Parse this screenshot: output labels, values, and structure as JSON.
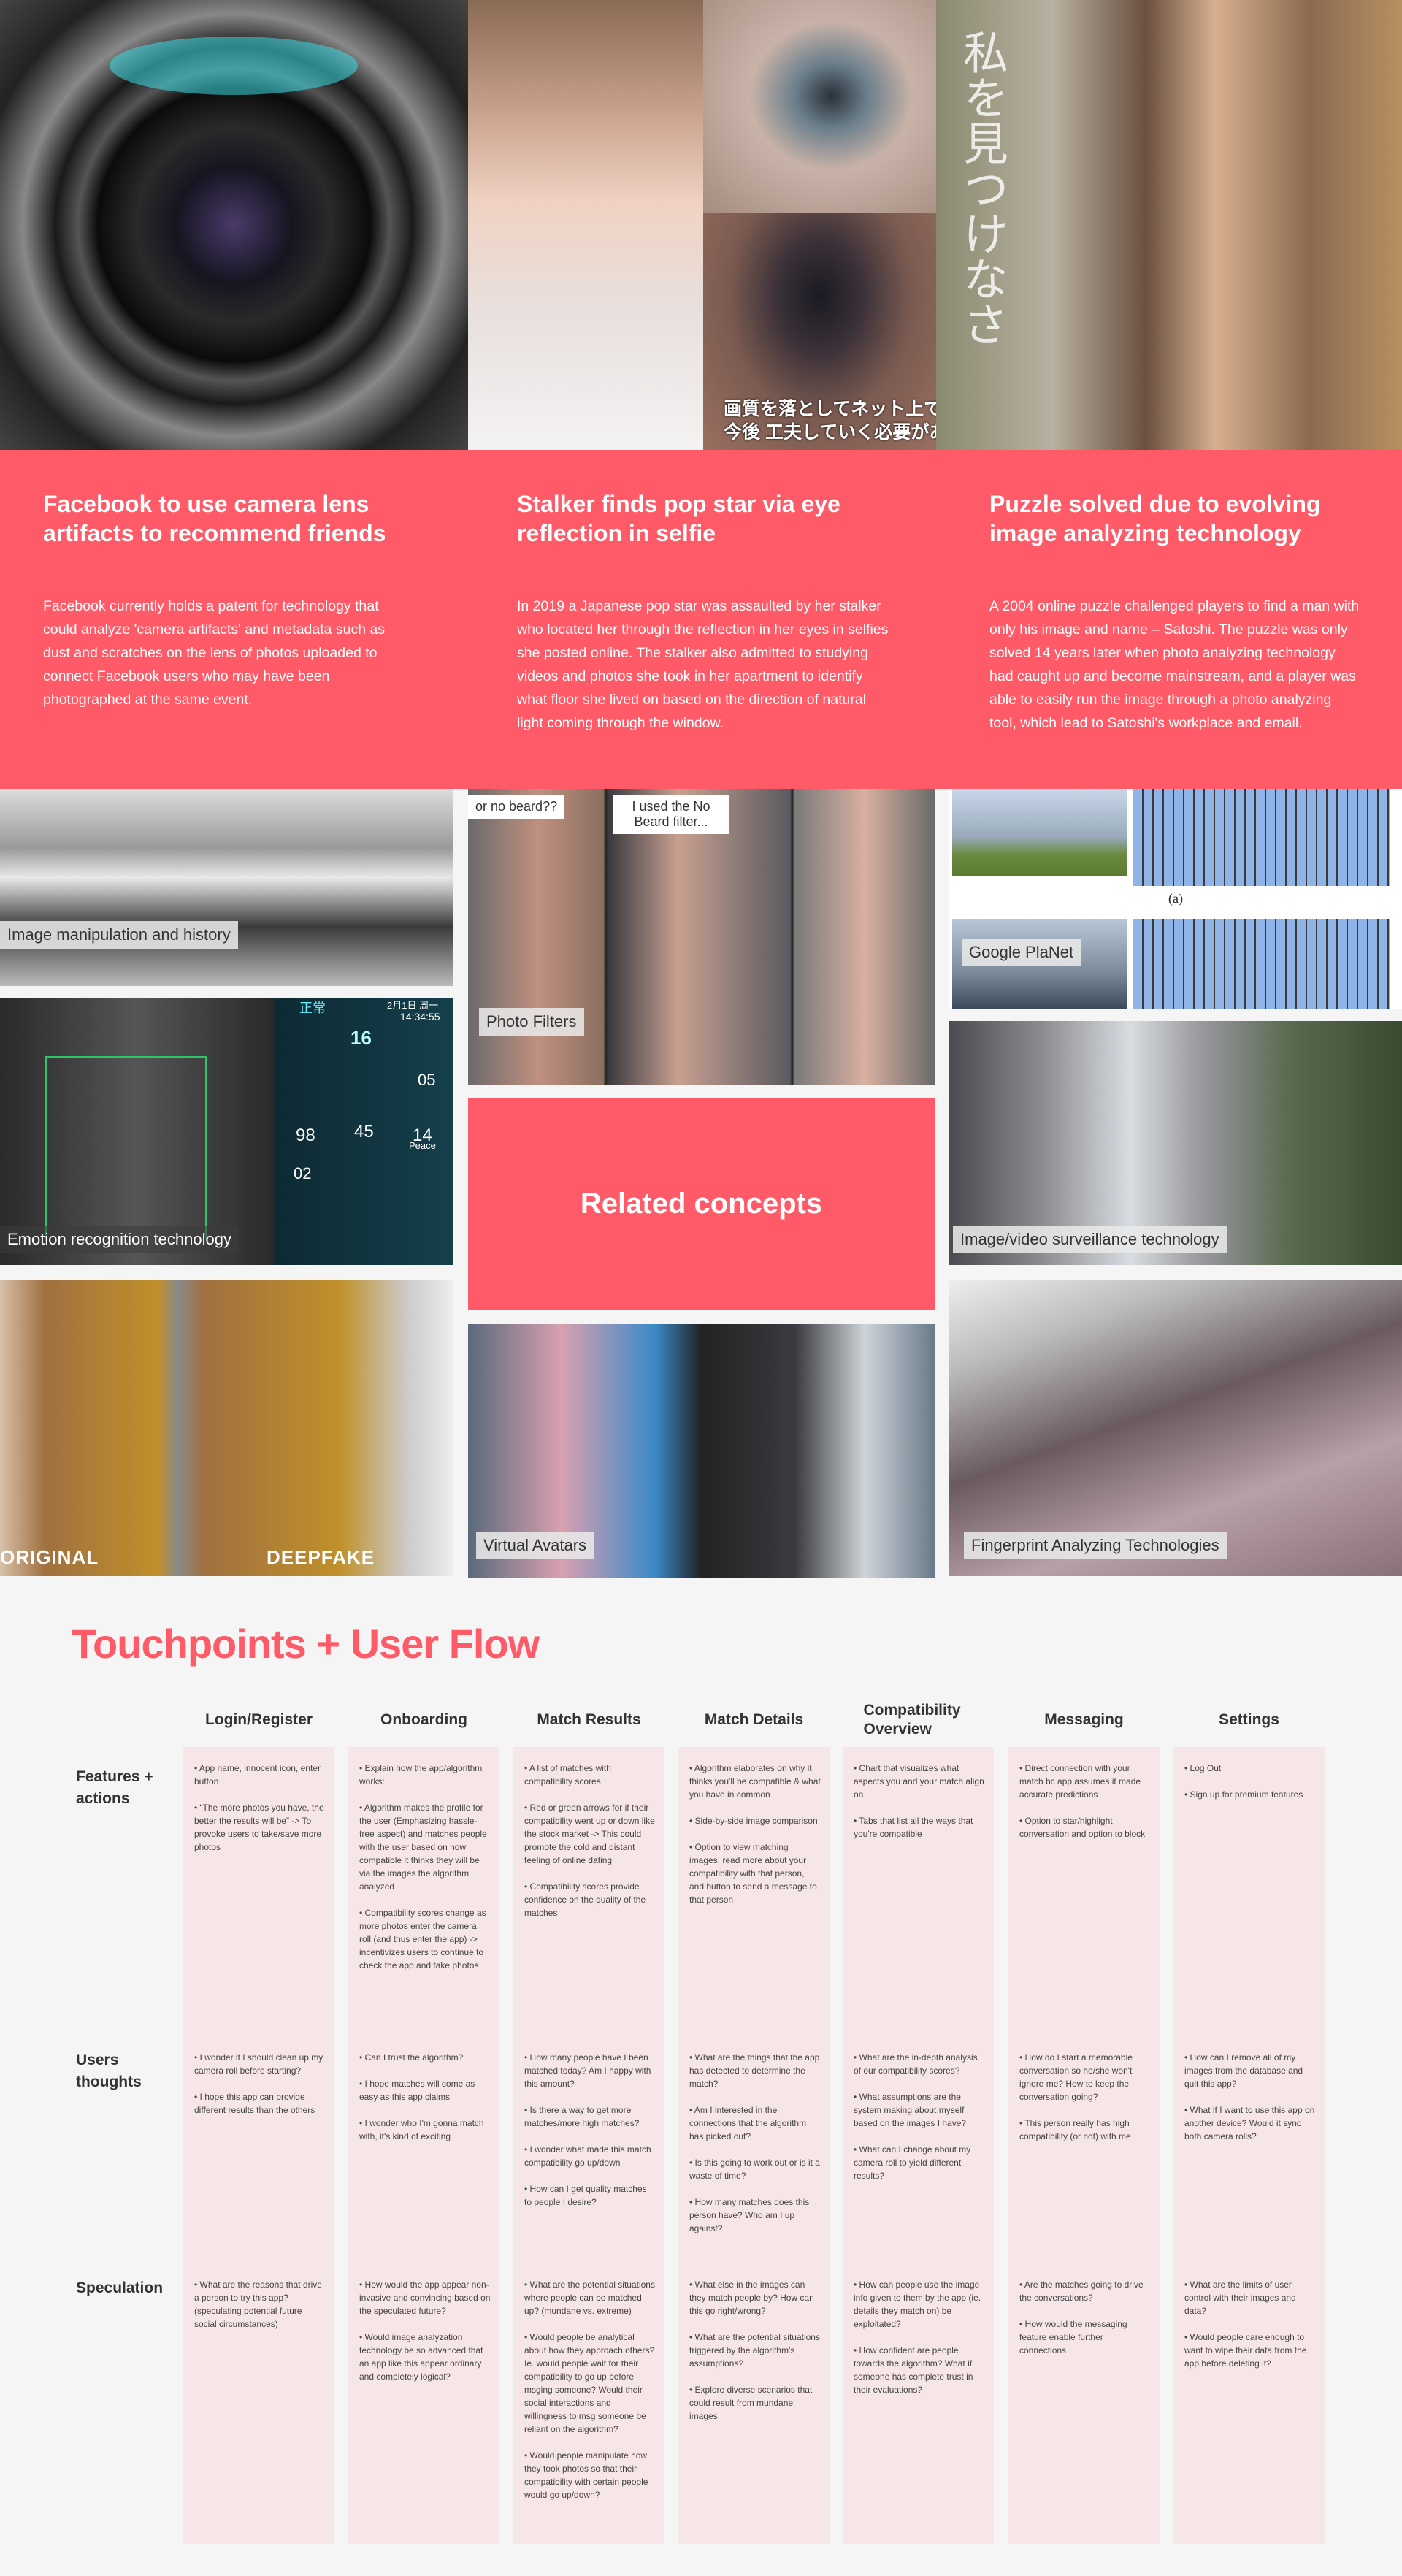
{
  "colors": {
    "accent": "#ff5a67",
    "cell_bg": "#f7e6e8",
    "page_bg": "#f5f5f5"
  },
  "hero_images": {
    "camera_lens": "camera-lens-photo",
    "pop_star": "pop-star-selfie-photo",
    "eye_reflection": "eye-reflection-photo",
    "news_caption": [
      "画質を落としてネット上で見られ",
      "今後 工夫していく必要があるのか"
    ],
    "puzzle_man": "satoshi-photo",
    "puzzle_text": "私を見つけなさ"
  },
  "stories": [
    {
      "title": "Facebook to use camera lens artifacts to recommend friends",
      "body": "Facebook currently holds a patent for technology that could analyze 'camera artifacts' and metadata such as dust and scratches on the lens of photos uploaded to connect Facebook users who may have been photographed at the same event."
    },
    {
      "title": "Stalker finds pop star via eye reflection in selfie",
      "body": "In 2019 a Japanese pop star was assaulted by her stalker who located her through the reflection in her eyes in selfies she posted online. The stalker also admitted to studying videos and photos she took in her apartment to identify what floor she lived on based on the direction of natural light coming through the window."
    },
    {
      "title": "Puzzle solved due to evolving image analyzing technology",
      "body": "A 2004 online puzzle challenged players to find a man with only his image and name – Satoshi. The puzzle was only solved 14 years later when photo analyzing technology had caught up and become mainstream, and a player was able to easily run the image through a photo analyzing tool, which lead to Satoshi's workplace and email."
    }
  ],
  "concepts": {
    "related_label": "Related concepts",
    "image_manipulation": "Image manipulation and history",
    "photo_filters": "Photo Filters",
    "photo_filters_overlays": [
      "or no beard??",
      "I used the No Beard filter..."
    ],
    "google_planet": "Google PlaNet",
    "google_planet_fig": "(a)",
    "emotion": "Emotion recognition technology",
    "emotion_hud": {
      "status": "正常",
      "date": "2月1日 周一",
      "time": "14:34:55",
      "speed": "16",
      "v1": "05",
      "v2": "98",
      "v3": "45",
      "v4": "14",
      "v5": "02",
      "mood": "Peace"
    },
    "surveillance": "Image/video surveillance technology",
    "deepfake_labels": [
      "ORIGINAL",
      "DEEPFAKE"
    ],
    "virtual_avatars": "Virtual Avatars",
    "fingerprint": "Fingerprint Analyzing Technologies"
  },
  "flow": {
    "title": "Touchpoints + User Flow",
    "columns": [
      "Login/Register",
      "Onboarding",
      "Match Results",
      "Match Details",
      "Compatibility Overview",
      "Messaging",
      "Settings"
    ],
    "rows": [
      "Features + actions",
      "Users thoughts",
      "Speculation"
    ],
    "cells": [
      [
        [
          "• App name, innocent icon, enter button",
          "• “The more photos you have, the better the results will be” -> To provoke users to take/save more photos"
        ],
        [
          "• I wonder if I should clean up my camera roll before starting?",
          "• I hope this app can provide different results than the others"
        ],
        [
          "• What are the reasons that drive a person to try this app? (speculating potential future social circumstances)"
        ]
      ],
      [
        [
          "• Explain how the app/algorithm works:",
          "• Algorithm makes the profile for the user (Emphasizing hassle-free aspect) and matches people with the user based on how compatible it thinks they will be via the images the algorithm analyzed",
          "• Compatibility scores change as more photos enter the camera roll (and thus enter the app) -> incentivizes users to continue to check the app and take photos"
        ],
        [
          "• Can I trust the algorithm?",
          "• I hope matches will come as easy as this app claims",
          "• I wonder who I'm gonna match with, it's kind of exciting"
        ],
        [
          "• How would the app appear non-invasive and convincing based on the speculated future?",
          "• Would image analyzation technology be so advanced that an app like this appear ordinary and completely logical?"
        ]
      ],
      [
        [
          "• A list of matches with compatibility scores",
          "• Red or green arrows for if their compatibility went up or down like the stock market -> This could promote the cold and distant feeling of online dating",
          "• Compatibility scores provide confidence on the quality of the matches"
        ],
        [
          "• How many people have I been matched today? Am I happy with this amount?",
          "• Is there a way to get more matches/more high matches?",
          "• I wonder what made this match compatibility go up/down",
          "• How can I get quality matches to people I desire?"
        ],
        [
          "• What are the potential situations where people can be matched up? (mundane vs. extreme)",
          "• Would people be analytical about how they approach others? Ie. would people wait for their compatibility to go up before msging someone? Would their social interactions and willingness to msg someone be reliant on the algorithm?",
          "• Would people manipulate how they took photos so that their compatibility with certain people would go up/down?"
        ]
      ],
      [
        [
          "• Algorithm elaborates on why it thinks you'll be compatible & what you have in common",
          "• Side-by-side image comparison",
          "• Option to view matching images, read more about your compatibility with that person, and button to send a message to that person"
        ],
        [
          "• What are the things that the app has detected to determine the match?",
          "•  Am I interested in the connections that the algorithm has picked out?",
          "• Is this going to work out or is it a waste of time?",
          "• How many matches does this person have? Who am I up against?"
        ],
        [
          "• What else in the images can they match people by? How can this go right/wrong?",
          "• What are the potential situations triggered by the algorithm's assumptions?",
          "• Explore diverse scenarios that could result from mundane images"
        ]
      ],
      [
        [
          "• Chart that visualizes what aspects you and your match align on",
          "• Tabs that list all the ways that you're compatible"
        ],
        [
          "• What are the in-depth analysis of our compatibility scores?",
          "• What assumptions are the system making about myself based on the images I have?",
          "• What can I change about my camera roll to yield different results?"
        ],
        [
          "• How can people use the image info given to them by the app (ie. details they match on) be exploitated?",
          "• How confident are people towards the algorithm? What if someone has complete trust in their evaluations?"
        ]
      ],
      [
        [
          "• Direct connection with your match bc app assumes it made accurate predictions",
          "• Option to star/highlight conversation and option to block"
        ],
        [
          "• How do I start a memorable conversation so he/she won't ignore me? How to keep the conversation going?",
          "• This person really has high compatibility (or not) with me"
        ],
        [
          "• Are the matches going to drive the conversations?",
          "• How would the messaging feature enable further connections"
        ]
      ],
      [
        [
          "• Log Out",
          "•  Sign up for premium features"
        ],
        [
          "• How can I remove all of my images from the database and quit this app?",
          "• What if I want to use this app on another device? Would it sync both camera rolls?"
        ],
        [
          "• What are the limits of user control with their images and data?",
          "• Would people care enough to want to wipe their data from the app before deleting it?"
        ]
      ]
    ]
  }
}
